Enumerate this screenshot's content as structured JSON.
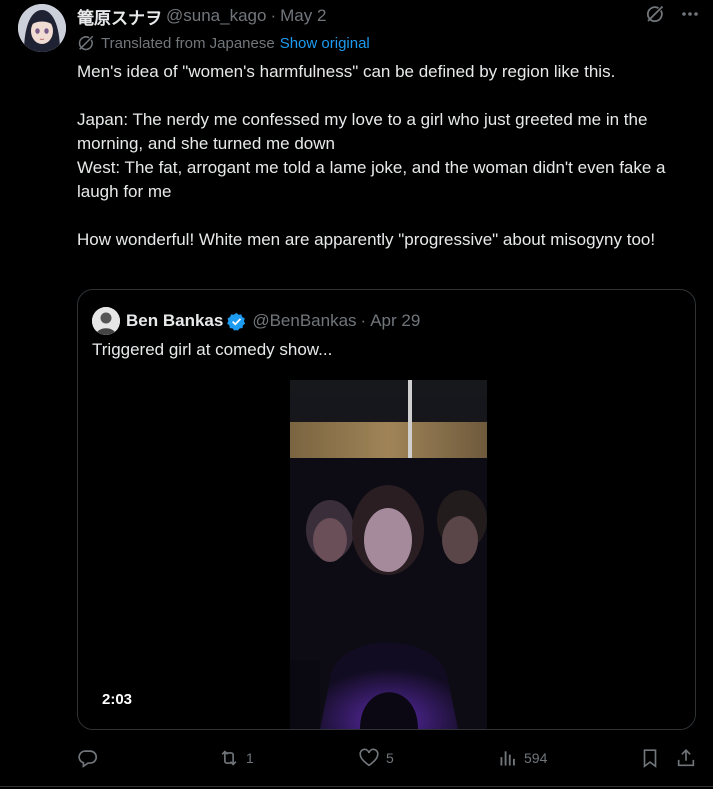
{
  "tweet": {
    "author_name": "篭原スナヲ",
    "handle": "@suna_kago",
    "separator": "·",
    "date": "May 2",
    "translated_label": "Translated from Japanese",
    "show_original_label": "Show original",
    "body": {
      "line1": "Men's idea of \"women's harmfulness\" can be defined by region like this.",
      "line2": "Japan: The nerdy me confessed my love to a girl who just greeted me in the morning, and she turned me down",
      "line3": "West: The fat, arrogant me told a lame joke, and the woman didn't even fake a laugh for me",
      "line4": "How wonderful! White men are apparently \"progressive\" about misogyny too!"
    }
  },
  "quote": {
    "author_name": "Ben Bankas",
    "handle": "@BenBankas",
    "separator": "·",
    "date": "Apr 29",
    "text": "Triggered girl at comedy show...",
    "video_duration": "2:03"
  },
  "actions": {
    "replies": "",
    "reposts": "1",
    "likes": "5",
    "views": "594"
  },
  "icons": {
    "grok": "grok-icon",
    "more": "more-icon",
    "translate": "translate-icon",
    "reply": "reply-icon",
    "repost": "repost-icon",
    "like": "like-icon",
    "views": "views-icon",
    "bookmark": "bookmark-icon",
    "share": "share-icon"
  },
  "colors": {
    "background": "#000000",
    "text": "#e7e9ea",
    "muted": "#71767b",
    "link": "#1d9bf0",
    "border": "#2f3336"
  }
}
